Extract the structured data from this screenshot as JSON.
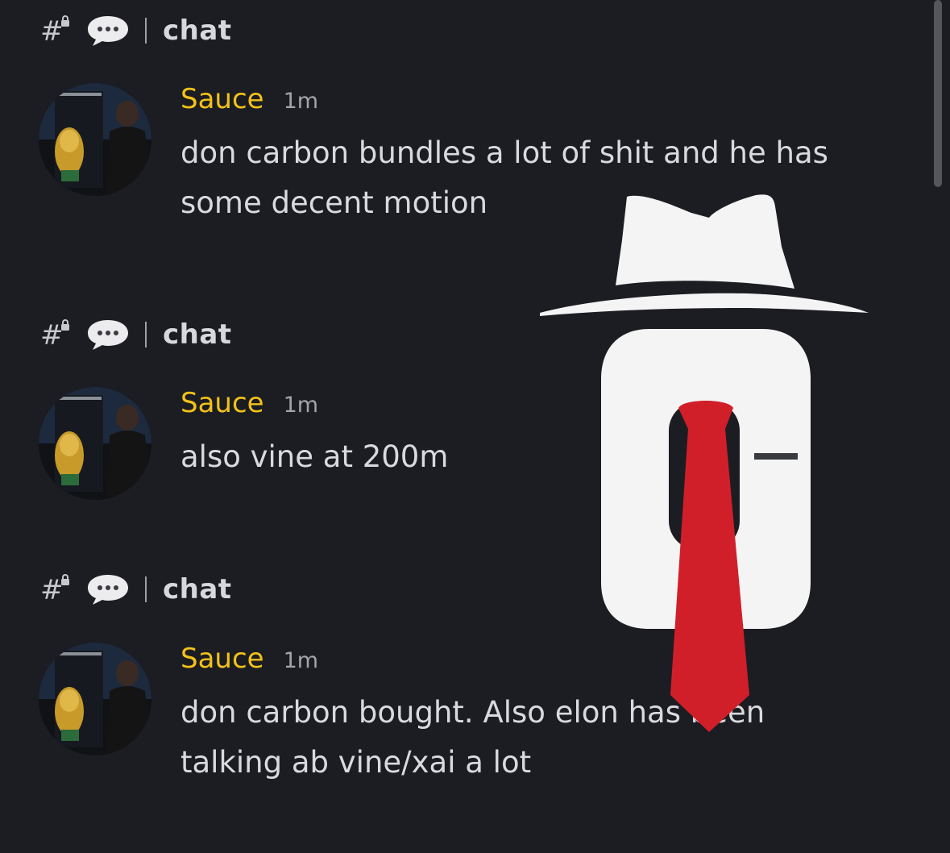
{
  "messages": [
    {
      "channel": "chat",
      "username": "Sauce",
      "time": "1m",
      "text": "don carbon bundles a lot of shit and he has some decent motion"
    },
    {
      "channel": "chat",
      "username": "Sauce",
      "time": "1m",
      "text": "also vine at 200m"
    },
    {
      "channel": "chat",
      "username": "Sauce",
      "time": "1m",
      "text": "don carbon bought. Also elon has been talking ab vine/xai a lot"
    }
  ],
  "icons": {
    "channel": "hashtag-lock-icon",
    "thread": "chat-bubble-icon",
    "overlay": "fedora-tie-logo"
  },
  "colors": {
    "background": "#1c1d22",
    "username": "#f2c21a",
    "text": "#d9dadd",
    "timestamp": "#a3a5aa",
    "tie": "#d11f2a"
  }
}
